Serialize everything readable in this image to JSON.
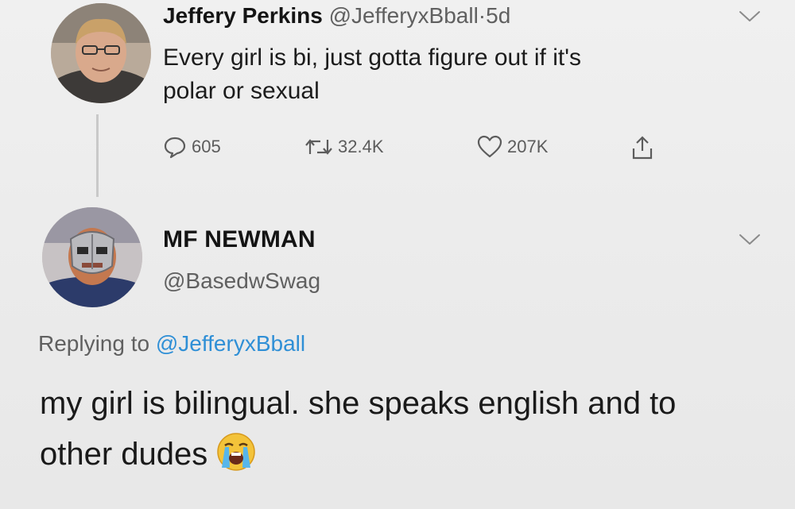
{
  "tweet1": {
    "name": "Jeffery Perkins",
    "handle": "@JefferyxBball",
    "separator": "·",
    "time": "5d",
    "text": "Every girl is bi, just gotta figure out if it's polar or sexual",
    "avatar_icon": "user-avatar-photo",
    "menu_icon": "chevron-down-icon",
    "actions": {
      "reply_count": "605",
      "retweet_count": "32.4K",
      "like_count": "207K",
      "reply_icon": "reply-icon",
      "retweet_icon": "retweet-icon",
      "like_icon": "heart-icon",
      "share_icon": "share-icon"
    }
  },
  "tweet2": {
    "name": "MF NEWMAN",
    "handle": "@BasedwSwag",
    "replying_prefix": "Replying to",
    "replying_handle": "@JefferyxBball",
    "text": "my girl is bilingual. she speaks english and to other dudes",
    "emoji_icon": "loudly-crying-face-emoji",
    "avatar_icon": "user-avatar-photo",
    "menu_icon": "chevron-down-icon"
  },
  "colors": {
    "background": "#ececec",
    "text": "#1f1f1f",
    "secondary": "#606060",
    "link": "#2f8fd6"
  }
}
